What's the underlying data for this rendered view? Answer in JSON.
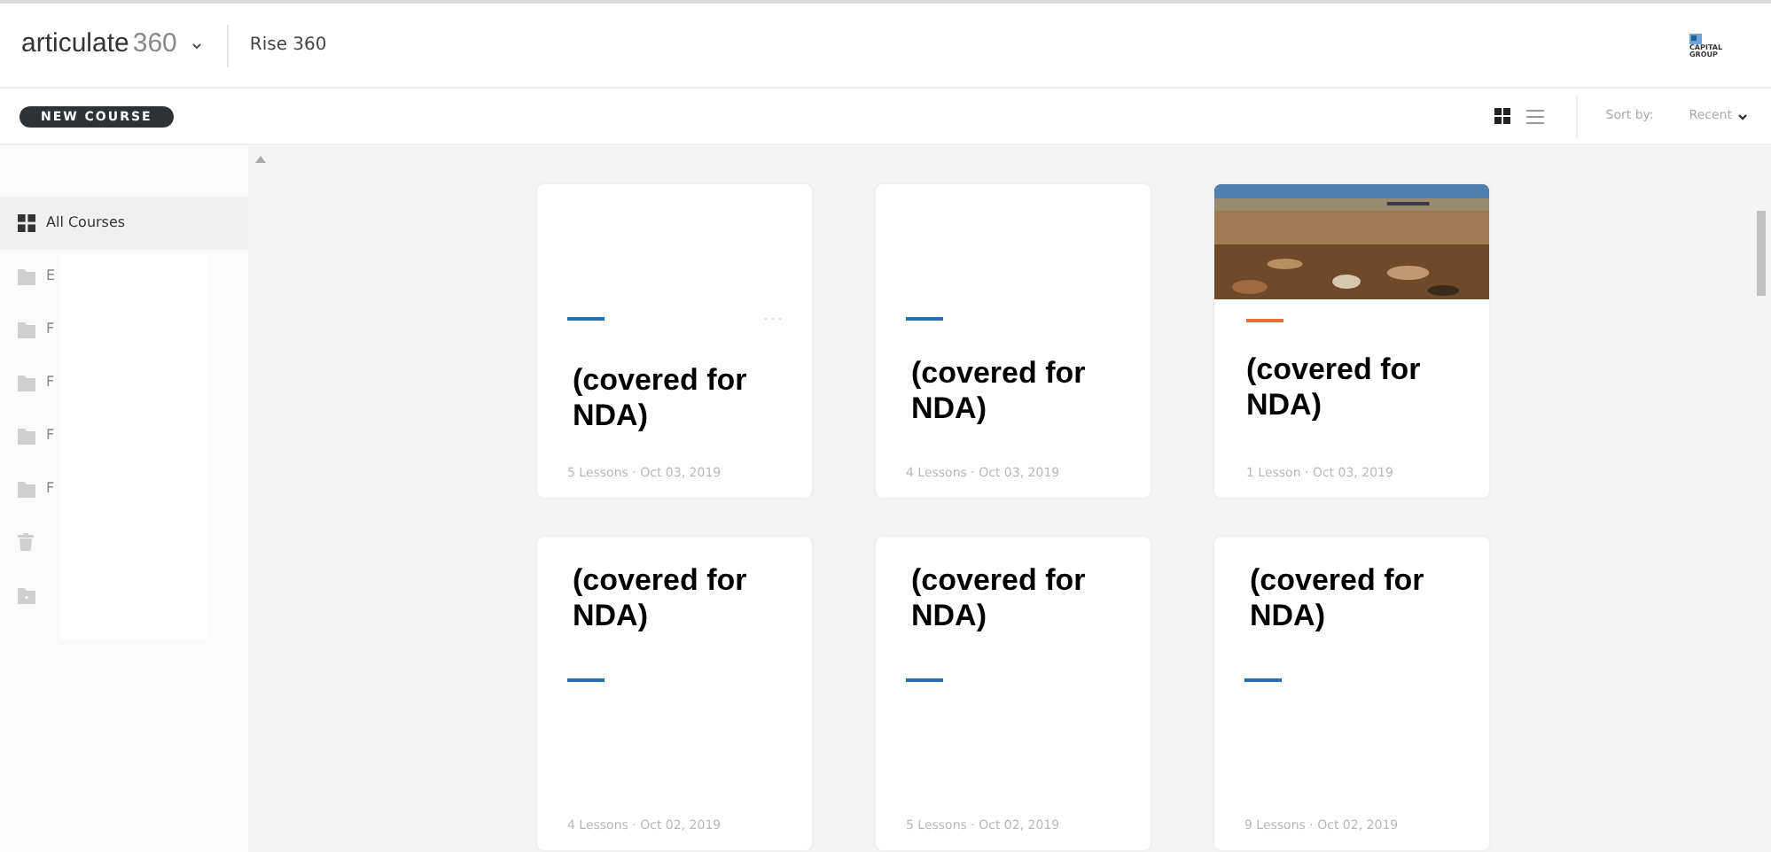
{
  "header": {
    "brand": "articulate",
    "brand_suffix": "360",
    "product": "Rise 360",
    "logo_text": "CAPITAL GROUP"
  },
  "toolbar": {
    "new_button": "NEW COURSE",
    "views": [
      {
        "kind": "grid",
        "selected": true
      },
      {
        "kind": "list",
        "selected": false
      }
    ],
    "sort_label": "Sort by:",
    "sort_value": "Recent"
  },
  "sidebar": {
    "items": [
      {
        "kind": "all",
        "label": "All Courses",
        "selected": true
      },
      {
        "kind": "folder",
        "label": "E",
        "selected": false
      },
      {
        "kind": "folder",
        "label": "F",
        "selected": false
      },
      {
        "kind": "folder",
        "label": "F",
        "selected": false
      },
      {
        "kind": "folder",
        "label": "F",
        "selected": false
      },
      {
        "kind": "folder",
        "label": "F",
        "selected": false
      },
      {
        "kind": "trash",
        "selected": false
      },
      {
        "kind": "add-folder",
        "selected": false
      }
    ]
  },
  "courses": [
    {
      "title": "(covered for NDA)",
      "meta": "5 Lessons · Oct 03, 2019",
      "color": "#1f6fb2",
      "kind": "plain",
      "menu": true
    },
    {
      "title": "(covered for NDA)",
      "meta": "4 Lessons · Oct 03, 2019",
      "color": "#1f6fb2",
      "kind": "plain",
      "menu": false
    },
    {
      "title": "(covered for NDA)",
      "meta": "1 Lesson · Oct 03, 2019",
      "color": "#f26b3a",
      "kind": "picture",
      "menu": false
    },
    {
      "title": "(covered for NDA)",
      "meta": "4 Lessons · Oct 02, 2019",
      "color": "#1f6fb2",
      "kind": "title-top",
      "menu": false
    },
    {
      "title": "(covered for NDA)",
      "meta": "5 Lessons · Oct 02, 2019",
      "color": "#1f6fb2",
      "kind": "title-top",
      "menu": false
    },
    {
      "title": "(covered for NDA)",
      "meta": "9 Lessons · Oct 02, 2019",
      "color": "#1f6fb2",
      "kind": "title-top",
      "menu": false
    }
  ]
}
